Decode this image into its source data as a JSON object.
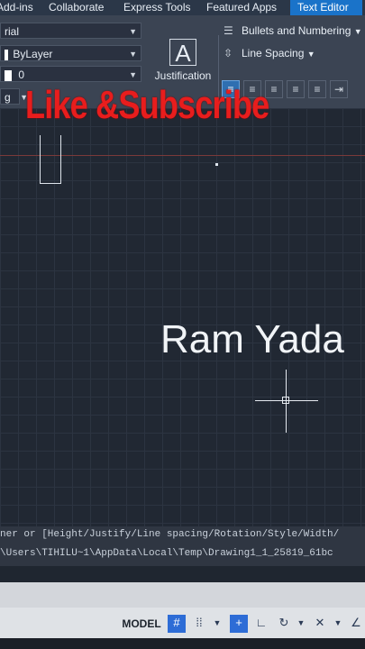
{
  "tabs": [
    "Add-ins",
    "Collaborate",
    "Express Tools",
    "Featured Apps",
    "Text Editor"
  ],
  "ribbon": {
    "font_combo": "rial",
    "color_combo": "ByLayer",
    "oblique_combo": "0",
    "small_combo": "g",
    "justification_label": "Justification",
    "bullets_label": "Bullets and Numbering",
    "line_spacing_label": "Line Spacing"
  },
  "overlay_text": "Like &Subscribe",
  "canvas": {
    "text_object": "Ram Yada"
  },
  "command": {
    "line1": "ner or [Height/Justify/Line spacing/Rotation/Style/Width/",
    "line2": "\\Users\\TIHILU~1\\AppData\\Local\\Temp\\Drawing1_1_25819_61bc"
  },
  "status": {
    "model_label": "MODEL"
  },
  "colors": {
    "active_tab": "#1a73c9",
    "overlay": "#e81d1d",
    "status_on": "#2d6cd6"
  }
}
